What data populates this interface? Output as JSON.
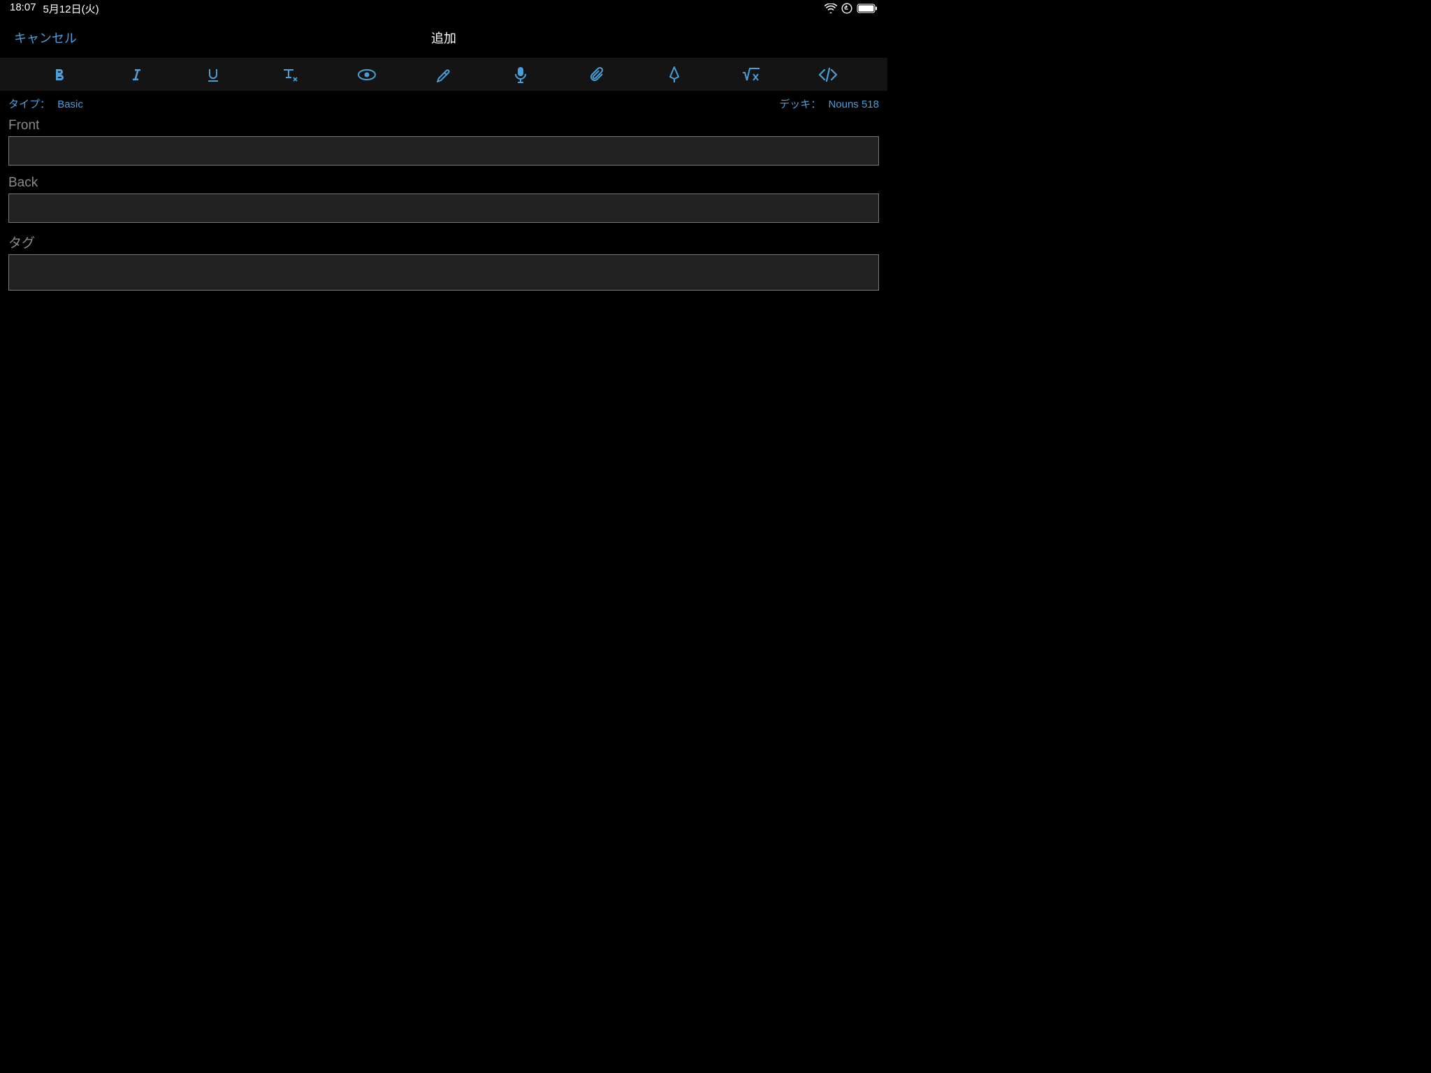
{
  "status_bar": {
    "time": "18:07",
    "date": "5月12日(火)"
  },
  "nav": {
    "cancel": "キャンセル",
    "title": "追加"
  },
  "meta": {
    "type_label": "タイプ：",
    "type_value": "Basic",
    "deck_label": "デッキ：",
    "deck_value": "Nouns 518"
  },
  "fields": {
    "front": {
      "label": "Front",
      "value": ""
    },
    "back": {
      "label": "Back",
      "value": ""
    },
    "tags": {
      "label": "タグ",
      "value": ""
    }
  },
  "colors": {
    "accent": "#4b9fd8",
    "bg": "#000000",
    "input_bg": "#212121",
    "input_border": "#7a7a7a",
    "muted": "#8a8a8a"
  }
}
